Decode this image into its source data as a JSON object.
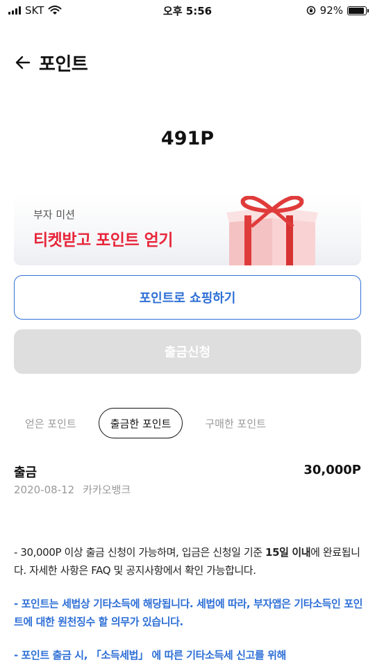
{
  "status_bar": {
    "carrier": "SKT",
    "time": "오후 5:56",
    "battery": "92%",
    "battery_level": 0.92
  },
  "header": {
    "title": "포인트"
  },
  "balance": "491P",
  "mission_banner": {
    "subtitle": "부자 미션",
    "title": "티켓받고 포인트 얻기"
  },
  "buttons": {
    "shop": "포인트로 쇼핑하기",
    "withdraw": "출금신청"
  },
  "tabs": [
    {
      "label": "얻은 포인트",
      "active": false
    },
    {
      "label": "출금한 포인트",
      "active": true
    },
    {
      "label": "구매한 포인트",
      "active": false
    }
  ],
  "record": {
    "type": "출금",
    "amount": "30,000P",
    "date": "2020-08-12",
    "bank": "카카오뱅크"
  },
  "notice": {
    "p1_part1": "- 30,000P 이상 출금 신청이 가능하며, 입금은 신청일 기준 ",
    "p1_bold": "15일 이내",
    "p1_part2": "에 완료됩니다. 자세한 사항은 FAQ 및 공지사항에서 확인 가능합니다.",
    "p2": "- 포인트는 세법상 기타소득에 해당됩니다. 세법에 따라, 부자앱은 기타소득인 포인트에 대한 원천징수 할 의무가 있습니다.",
    "p3": "- 포인트 출금 시, 「소득세법」 에 따른 기타소득세 신고를 위해"
  },
  "colors": {
    "accent_blue": "#2e6fd6",
    "mission_red": "#e8253a",
    "disabled_gray": "#dedede"
  },
  "icons": [
    "signal-icon",
    "wifi-icon",
    "orientation-lock-icon",
    "battery-icon",
    "back-arrow-icon",
    "gift-icon"
  ]
}
